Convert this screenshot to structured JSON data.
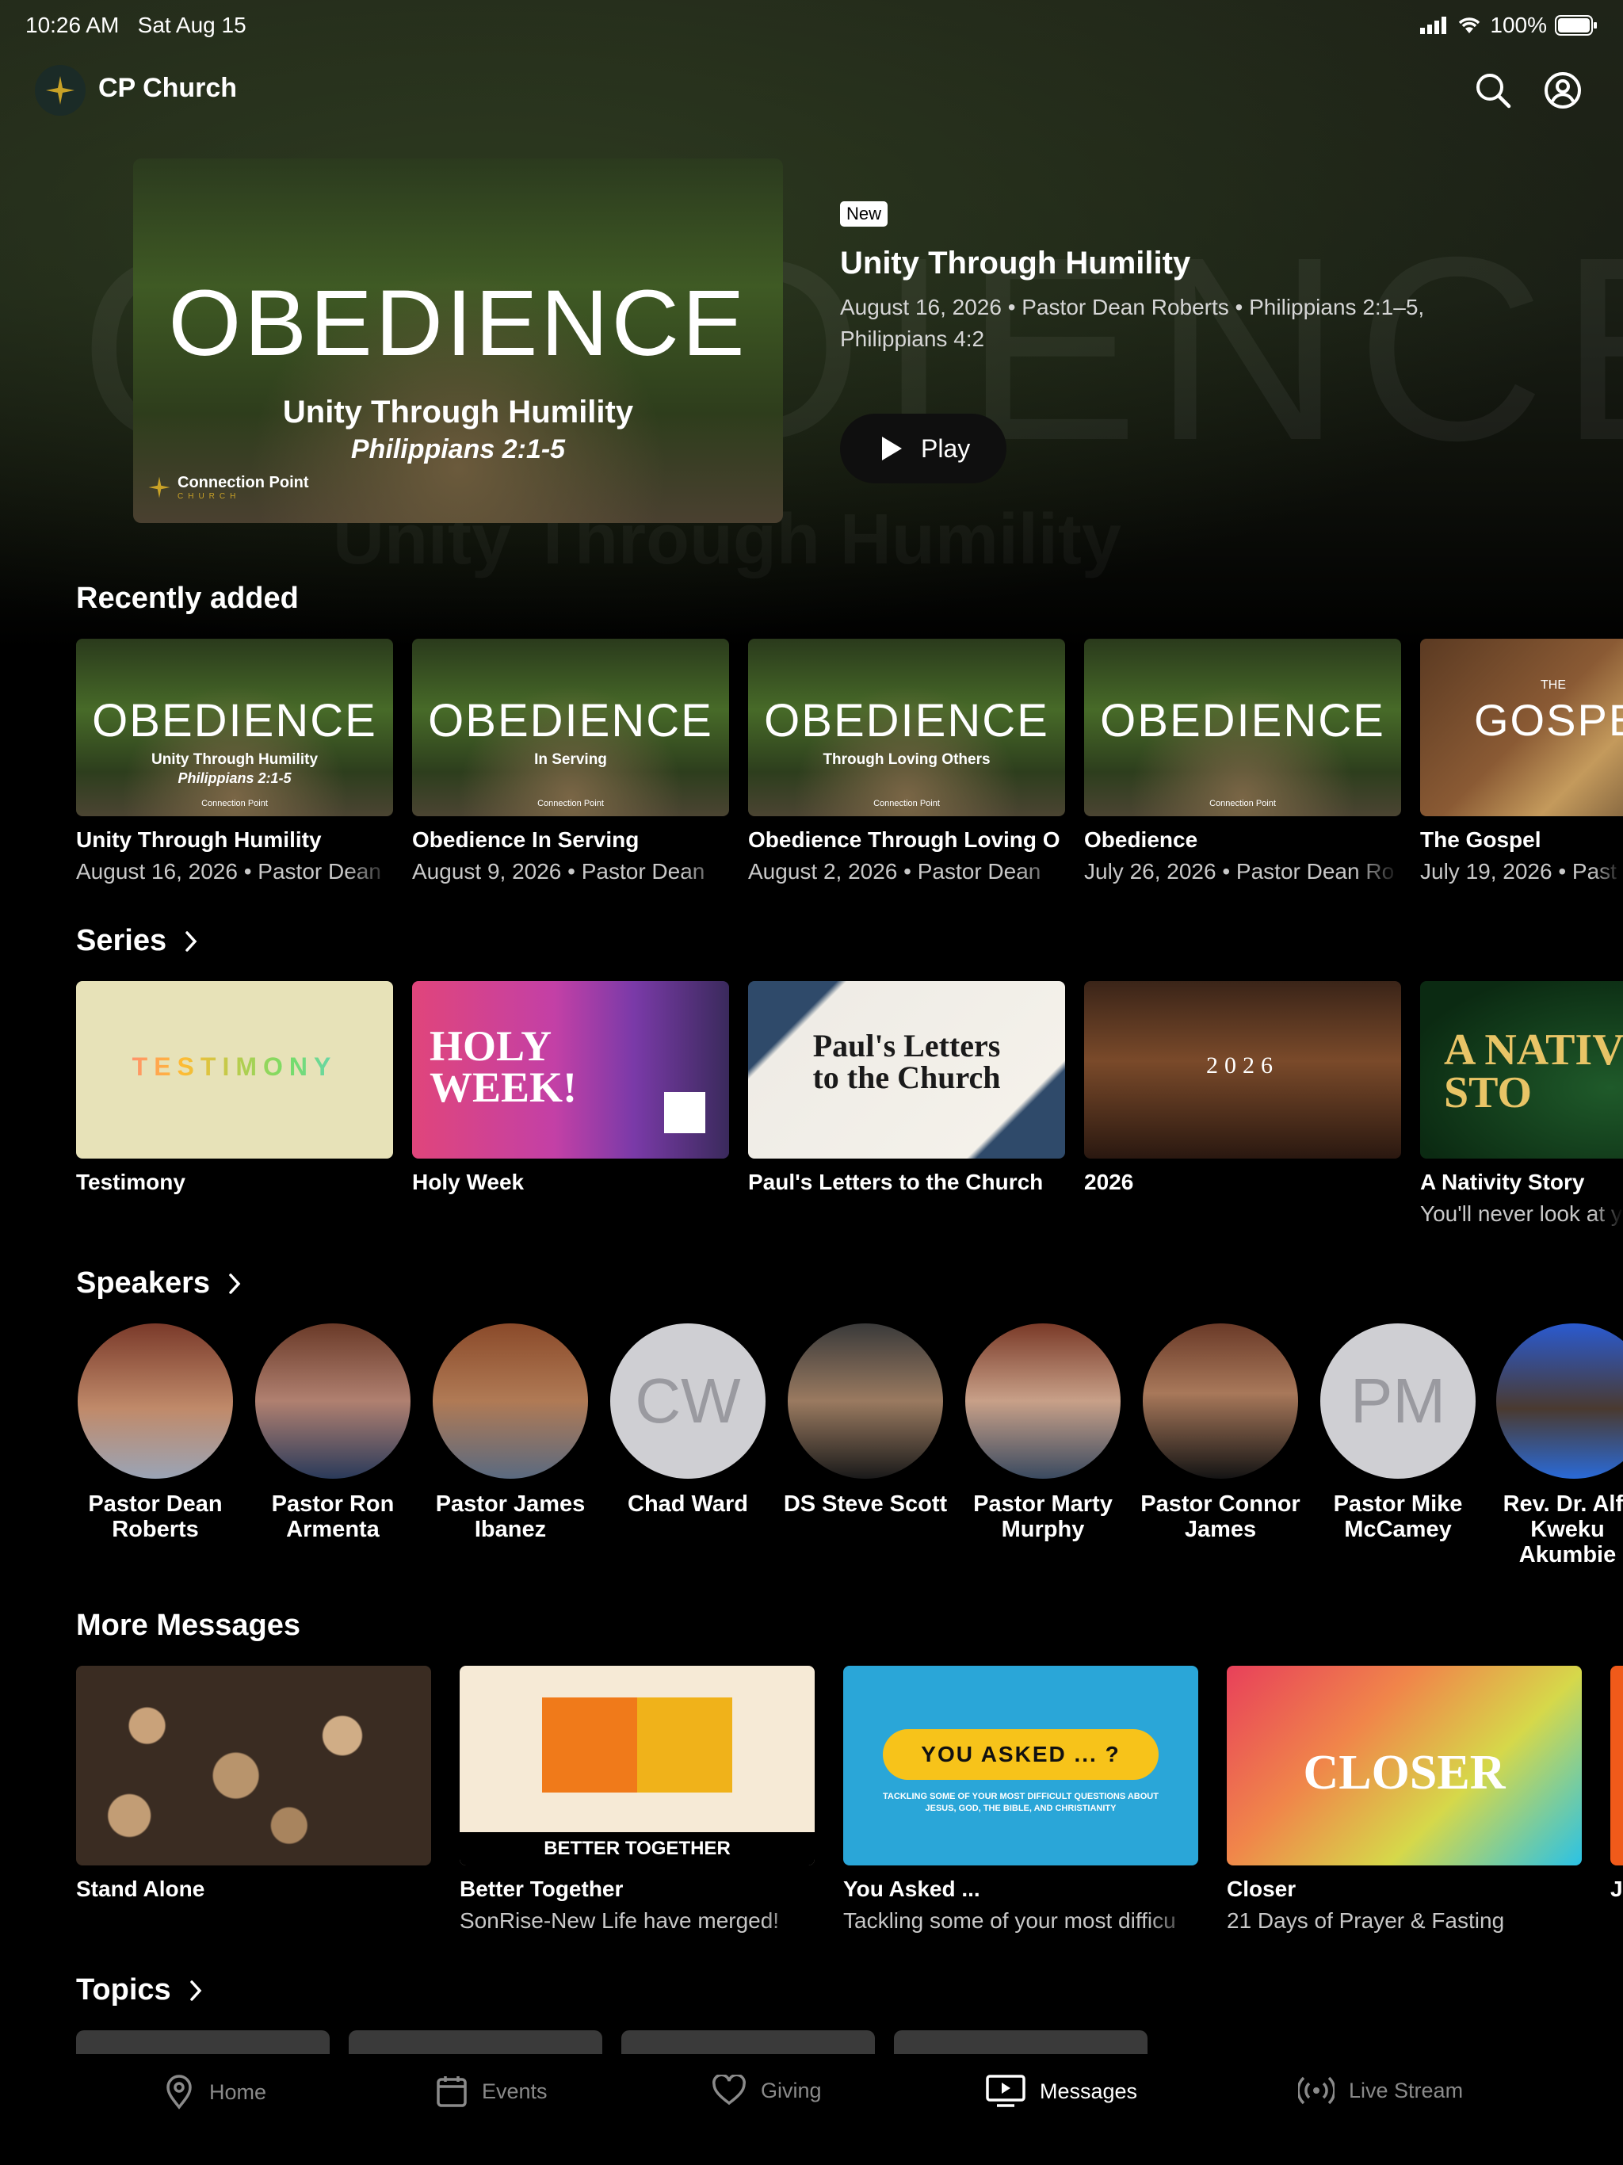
{
  "status": {
    "time": "10:26 AM",
    "date": "Sat Aug 15",
    "battery": "100%"
  },
  "app": {
    "title": "CP Church"
  },
  "hero": {
    "thumb_word": "OBEDIENCE",
    "thumb_subtitle": "Unity Through Humility",
    "thumb_verse": "Philippians 2:1-5",
    "thumb_brand": "Connection Point",
    "thumb_brand_sub": "CHURCH",
    "badge": "New",
    "title": "Unity Through Humility",
    "meta": "August 16, 2026 • Pastor Dean Roberts • Philippians 2:1–5, Philippians 4:2",
    "play_label": "Play"
  },
  "recent": {
    "heading": "Recently added",
    "items": [
      {
        "title": "Unity Through Humility",
        "meta": "August 16, 2026 • Pastor Dean",
        "thumb_sub": "Unity Through Humility",
        "thumb_verse": "Philippians 2:1-5"
      },
      {
        "title": "Obedience In Serving",
        "meta": "August 9, 2026 • Pastor Dean",
        "thumb_sub": "In Serving",
        "thumb_verse": ""
      },
      {
        "title": "Obedience Through Loving O",
        "meta": "August 2, 2026 • Pastor Dean",
        "thumb_sub": "Through Loving Others",
        "thumb_verse": ""
      },
      {
        "title": "Obedience",
        "meta": "July 26, 2026 • Pastor Dean Ro",
        "thumb_sub": "",
        "thumb_verse": ""
      },
      {
        "title": "The Gospel",
        "meta": "July 19, 2026 • Past",
        "thumb_word": "GOSPE",
        "thumb_small": "THE"
      }
    ],
    "thumb_word": "OBEDIENCE",
    "thumb_brand": "Connection Point"
  },
  "series": {
    "heading": "Series",
    "items": [
      {
        "title": "Testimony",
        "subtitle": "",
        "thumb_text": "TESTIMONY"
      },
      {
        "title": "Holy Week",
        "subtitle": "",
        "thumb_text": "HOLY WEEK!"
      },
      {
        "title": "Paul's Letters to the Church",
        "subtitle": "",
        "thumb_text": "Paul's Letters to the Church"
      },
      {
        "title": "2026",
        "subtitle": "",
        "thumb_text": "2026"
      },
      {
        "title": "A Nativity Story",
        "subtitle": "You'll never look at y",
        "thumb_text": "A NATIVI STO"
      }
    ]
  },
  "speakers": {
    "heading": "Speakers",
    "items": [
      {
        "name": "Pastor Dean Roberts",
        "initials": "",
        "photo": true
      },
      {
        "name": "Pastor Ron Armenta",
        "initials": "",
        "photo": true
      },
      {
        "name": "Pastor James Ibanez",
        "initials": "",
        "photo": true
      },
      {
        "name": "Chad Ward",
        "initials": "CW",
        "photo": false
      },
      {
        "name": "DS Steve Scott",
        "initials": "",
        "photo": true
      },
      {
        "name": "Pastor Marty Murphy",
        "initials": "",
        "photo": true
      },
      {
        "name": "Pastor Connor James",
        "initials": "",
        "photo": true
      },
      {
        "name": "Pastor Mike McCamey",
        "initials": "PM",
        "photo": false
      },
      {
        "name": "Rev. Dr. Alfr Kweku Akumbie",
        "initials": "",
        "photo": true
      }
    ]
  },
  "more": {
    "heading": "More Messages",
    "items": [
      {
        "title": "Stand Alone",
        "subtitle": ""
      },
      {
        "title": "Better Together",
        "subtitle": "SonRise-New Life have merged!",
        "thumb_text": "BETTER TOGETHER"
      },
      {
        "title": "You Asked ...",
        "subtitle": "Tackling some of your most difficu",
        "thumb_text": "YOU ASKED ... ?",
        "thumb_sub": "TACKLING SOME OF YOUR MOST DIFFICULT QUESTIONS ABOUT JESUS, GOD, THE BIBLE, AND CHRISTIANITY"
      },
      {
        "title": "Closer",
        "subtitle": "21 Days of Prayer & Fasting",
        "thumb_text": "CLOSER"
      },
      {
        "title": "J",
        "subtitle": ""
      }
    ]
  },
  "topics": {
    "heading": "Topics"
  },
  "tabs": [
    {
      "label": "Home",
      "icon": "location-pin-icon"
    },
    {
      "label": "Events",
      "icon": "calendar-icon"
    },
    {
      "label": "Giving",
      "icon": "heart-icon"
    },
    {
      "label": "Messages",
      "icon": "tv-play-icon"
    },
    {
      "label": "Live Stream",
      "icon": "broadcast-icon"
    }
  ],
  "colors": {
    "background": "#000000",
    "muted_text": "#8a8a8a",
    "accent_gold": "#c9a227"
  }
}
